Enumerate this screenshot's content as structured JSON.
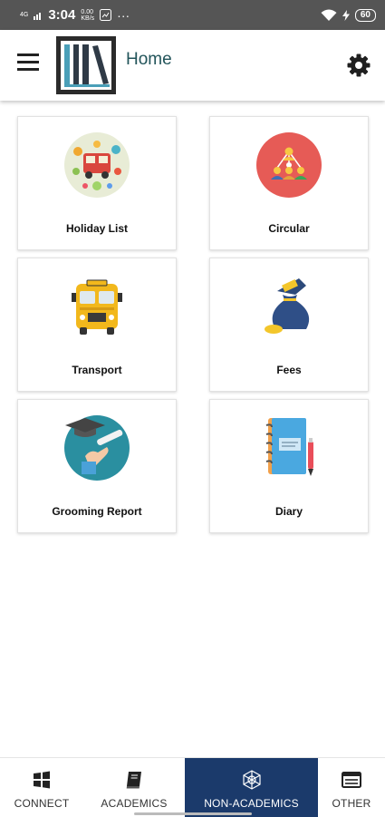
{
  "status_bar": {
    "network": "4G",
    "time": "3:04",
    "speed_value": "0.00",
    "speed_unit": "KB/s",
    "dots": "···",
    "battery": "60"
  },
  "header": {
    "title": "Home",
    "menu_icon": "hamburger-menu-icon",
    "settings_icon": "gear-icon"
  },
  "cards": [
    {
      "label": "Holiday List",
      "icon": "holiday-icon"
    },
    {
      "label": "Circular",
      "icon": "circular-icon"
    },
    {
      "label": "Transport",
      "icon": "bus-icon"
    },
    {
      "label": "Fees",
      "icon": "money-bag-icon"
    },
    {
      "label": "Grooming Report",
      "icon": "graduation-cap-icon"
    },
    {
      "label": "Diary",
      "icon": "notebook-icon"
    }
  ],
  "bottom_nav": {
    "items": [
      {
        "label": "CONNECT",
        "icon": "windows-grid-icon"
      },
      {
        "label": "ACADEMICS",
        "icon": "book-icon"
      },
      {
        "label": "NON-ACADEMICS",
        "icon": "network-icon",
        "active": true
      },
      {
        "label": "OTHER",
        "icon": "list-window-icon"
      }
    ]
  },
  "colors": {
    "status_bar": "#555555",
    "title": "#22545a",
    "nav_active": "#1b3a6b"
  }
}
